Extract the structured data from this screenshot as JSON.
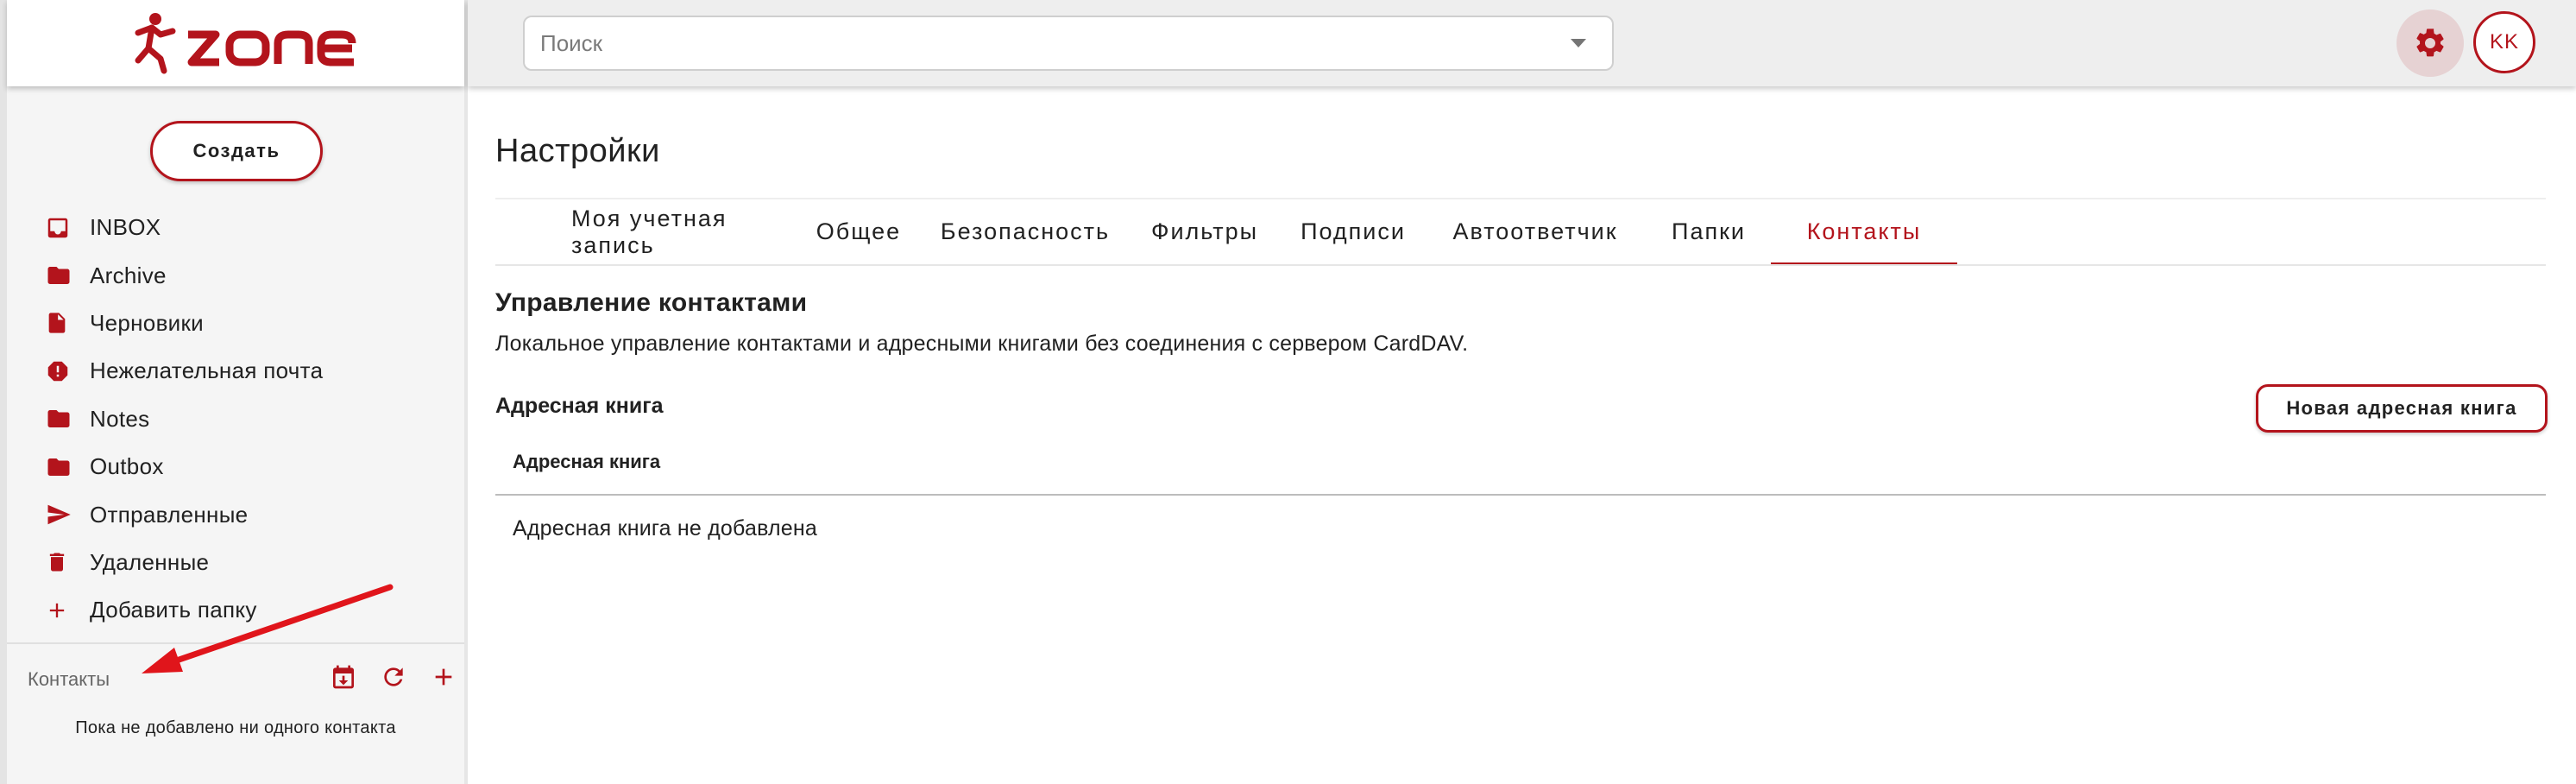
{
  "brand": {
    "logo_text": "zone",
    "accent": "#b3141c"
  },
  "sidebar": {
    "create_label": "Создать",
    "folders": [
      {
        "label": "INBOX",
        "icon": "inbox-icon"
      },
      {
        "label": "Archive",
        "icon": "folder-icon"
      },
      {
        "label": "Черновики",
        "icon": "draft-icon"
      },
      {
        "label": "Нежелательная почта",
        "icon": "spam-icon"
      },
      {
        "label": "Notes",
        "icon": "folder-icon"
      },
      {
        "label": "Outbox",
        "icon": "folder-icon"
      },
      {
        "label": "Отправленные",
        "icon": "send-icon"
      },
      {
        "label": "Удаленные",
        "icon": "trash-icon"
      },
      {
        "label": "Добавить папку",
        "icon": "plus-icon"
      }
    ],
    "contacts": {
      "label": "Контакты",
      "empty_text": "Пока не добавлено ни одного контакта"
    }
  },
  "topbar": {
    "search_placeholder": "Поиск",
    "avatar_initials": "KK"
  },
  "settings": {
    "title": "Настройки",
    "tabs": [
      {
        "label": "Моя учетная запись",
        "active": false
      },
      {
        "label": "Общее",
        "active": false
      },
      {
        "label": "Безопасность",
        "active": false
      },
      {
        "label": "Фильтры",
        "active": false
      },
      {
        "label": "Подписи",
        "active": false
      },
      {
        "label": "Автоответчик",
        "active": false
      },
      {
        "label": "Папки",
        "active": false
      },
      {
        "label": "Контакты",
        "active": true
      }
    ],
    "section_title": "Управление контактами",
    "section_desc": "Локальное управление контактами и адресными книгами без соединения с сервером CardDAV.",
    "addressbook_label": "Адресная книга",
    "new_addressbook_button": "Новая адресная книга",
    "table": {
      "header": "Адресная книга",
      "empty_text": "Адресная книга не добавлена"
    }
  }
}
